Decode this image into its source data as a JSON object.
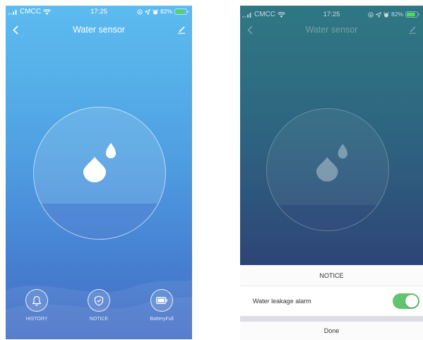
{
  "main_screen": {
    "status_bar": {
      "carrier": "CMCC",
      "time": "17:25",
      "battery": "82%"
    },
    "header": {
      "back_icon": "back-chevron-icon",
      "title": "Water sensor",
      "edit_icon": "edit-pencil-icon"
    },
    "sensor_icon": "water-drop-icon",
    "actions": [
      {
        "label": "HISTORY",
        "icon": "bell-icon"
      },
      {
        "label": "NOTICE",
        "icon": "shield-check-icon"
      },
      {
        "label": "BatteryFull",
        "icon": "battery-icon"
      }
    ]
  },
  "notice_screen": {
    "status_bar": {
      "carrier": "CMCC",
      "time": "17:25",
      "battery": "82%"
    },
    "header": {
      "back_icon": "back-chevron-icon",
      "title": "Water sensor",
      "edit_icon": "edit-pencil-icon"
    },
    "sensor_icon": "water-drop-icon",
    "notice_sheet": {
      "title": "NOTICE",
      "options": [
        {
          "label": "Water leakage alarm",
          "enabled": true
        }
      ],
      "done_label": "Done"
    }
  },
  "colors": {
    "toggle_on": "#62c370",
    "battery_level": "#4cd964"
  }
}
